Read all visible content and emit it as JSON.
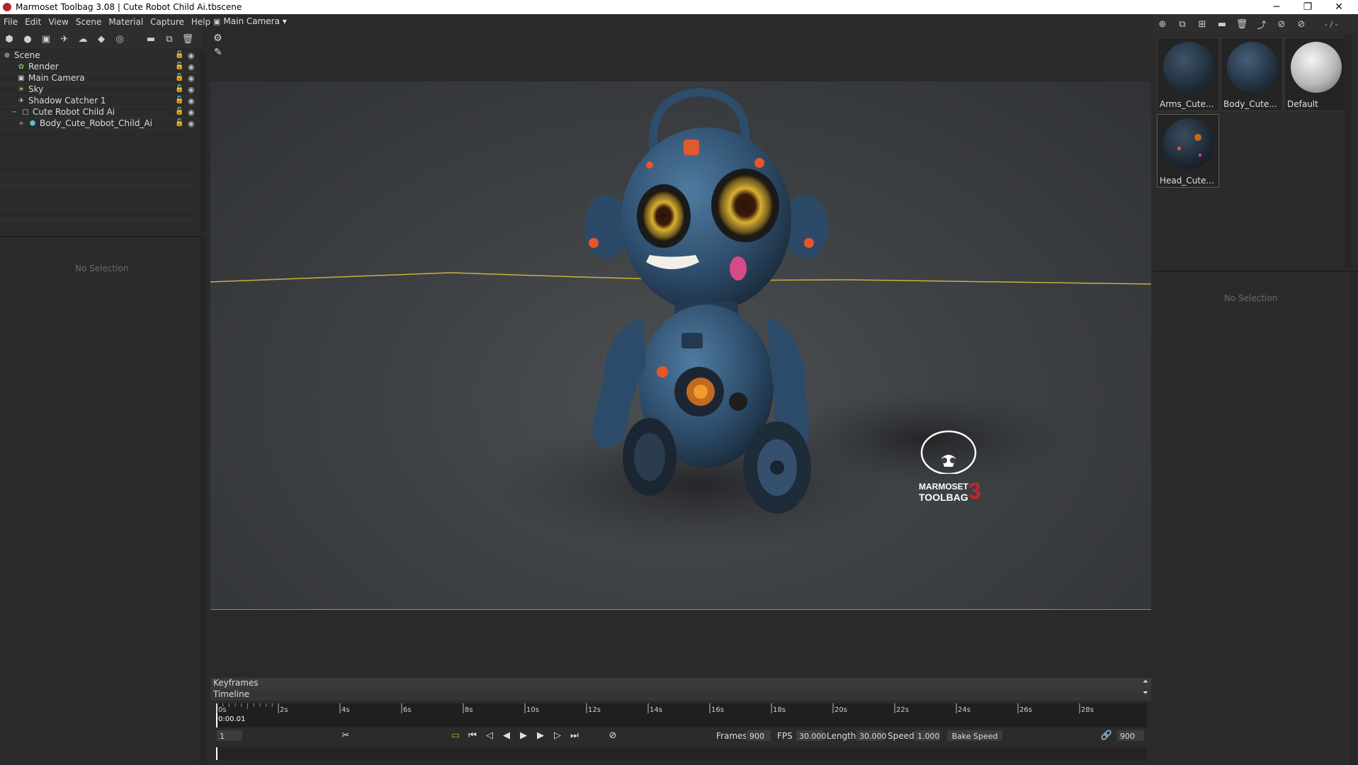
{
  "window": {
    "title": "Marmoset Toolbag 3.08  |  Cute Robot Child Ai.tbscene",
    "minimize": "─",
    "restore": "❐",
    "close": "✕"
  },
  "menu": [
    "File",
    "Edit",
    "View",
    "Scene",
    "Material",
    "Capture",
    "Help"
  ],
  "scene_tree": [
    {
      "label": "Scene",
      "icon": "scene-icon"
    },
    {
      "label": "Render",
      "icon": "render-icon"
    },
    {
      "label": "Main Camera",
      "icon": "camera-icon"
    },
    {
      "label": "Sky",
      "icon": "sky-icon"
    },
    {
      "label": "Shadow Catcher 1",
      "icon": "shadow-catcher-icon"
    },
    {
      "label": "Cute Robot Child Ai",
      "icon": "object-icon"
    },
    {
      "label": "Body_Cute_Robot_Child_Ai",
      "icon": "mesh-icon"
    }
  ],
  "left_props": {
    "no_selection": "No Selection"
  },
  "viewport": {
    "camera_menu": "Main Camera ▾",
    "logo_line1": "MARMOSET",
    "logo_line2": "TOOLBAG",
    "logo_number": "3"
  },
  "materials": [
    {
      "label": "Arms_Cute...",
      "color": "#23323f"
    },
    {
      "label": "Body_Cute...",
      "color": "#263444"
    },
    {
      "label": "Default",
      "color": "#cfcfcf"
    },
    {
      "label": "Head_Cute...",
      "color": "#1f2a36"
    }
  ],
  "right_toolbar": {
    "preset": "- / -"
  },
  "right_props": {
    "no_selection": "No Selection"
  },
  "timeline": {
    "keyframes_label": "Keyframes",
    "timeline_label": "Timeline",
    "current_time": "0:00.01",
    "tick_labels": [
      "0s",
      "2s",
      "4s",
      "6s",
      "8s",
      "10s",
      "12s",
      "14s",
      "16s",
      "18s",
      "20s",
      "22s",
      "24s",
      "26s",
      "28s"
    ],
    "frame_field": "1",
    "frames_label": "Frames",
    "frames_value": "900",
    "fps_label": "FPS",
    "fps_value": "30.000",
    "length_label": "Length",
    "length_value": "30.000",
    "speed_label": "Speed",
    "speed_value": "1.000",
    "bake_speed_label": "Bake Speed",
    "end_frame_value": "900"
  }
}
